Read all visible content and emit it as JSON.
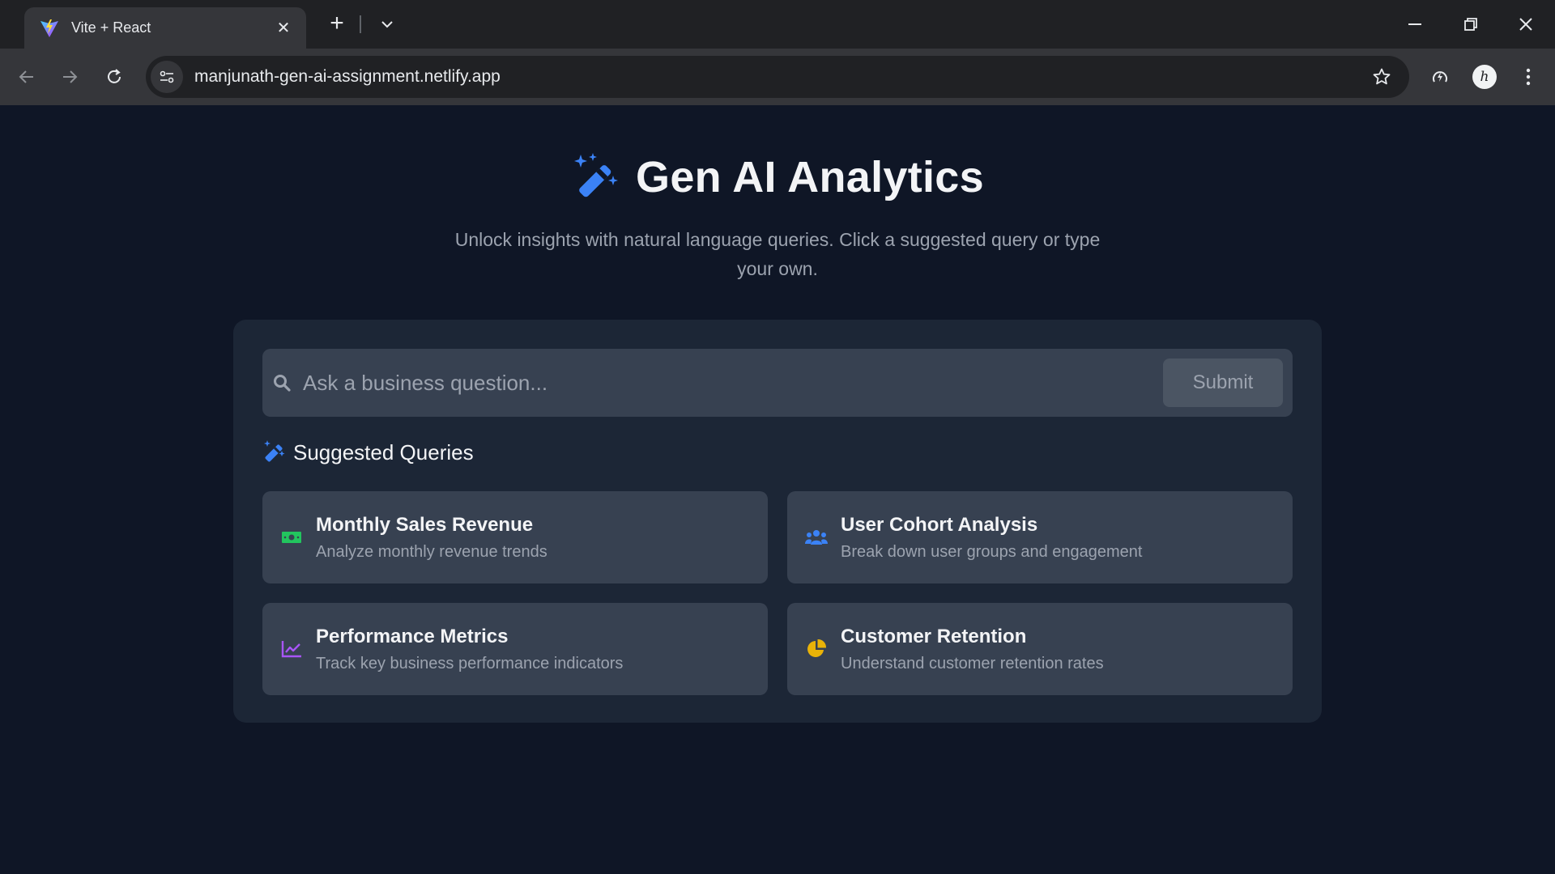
{
  "browser": {
    "tab_title": "Vite + React",
    "url": "manjunath-gen-ai-assignment.netlify.app",
    "avatar_initial": "h"
  },
  "hero": {
    "title": "Gen AI Analytics",
    "subtitle": "Unlock insights with natural language queries. Click a suggested query or type your own."
  },
  "search": {
    "placeholder": "Ask a business question...",
    "value": "",
    "submit_label": "Submit"
  },
  "suggestions": {
    "heading": "Suggested Queries",
    "items": [
      {
        "title": "Monthly Sales Revenue",
        "description": "Analyze monthly revenue trends",
        "icon": "money-bill-icon",
        "color": "#22c55e"
      },
      {
        "title": "User Cohort Analysis",
        "description": "Break down user groups and engagement",
        "icon": "users-icon",
        "color": "#3b82f6"
      },
      {
        "title": "Performance Metrics",
        "description": "Track key business performance indicators",
        "icon": "line-chart-icon",
        "color": "#a855f7"
      },
      {
        "title": "Customer Retention",
        "description": "Understand customer retention rates",
        "icon": "pie-chart-icon",
        "color": "#eab308"
      }
    ]
  },
  "colors": {
    "page_bg": "#0f1626",
    "panel_bg": "#1c2636",
    "card_bg": "#374151",
    "accent": "#3b82f6"
  }
}
